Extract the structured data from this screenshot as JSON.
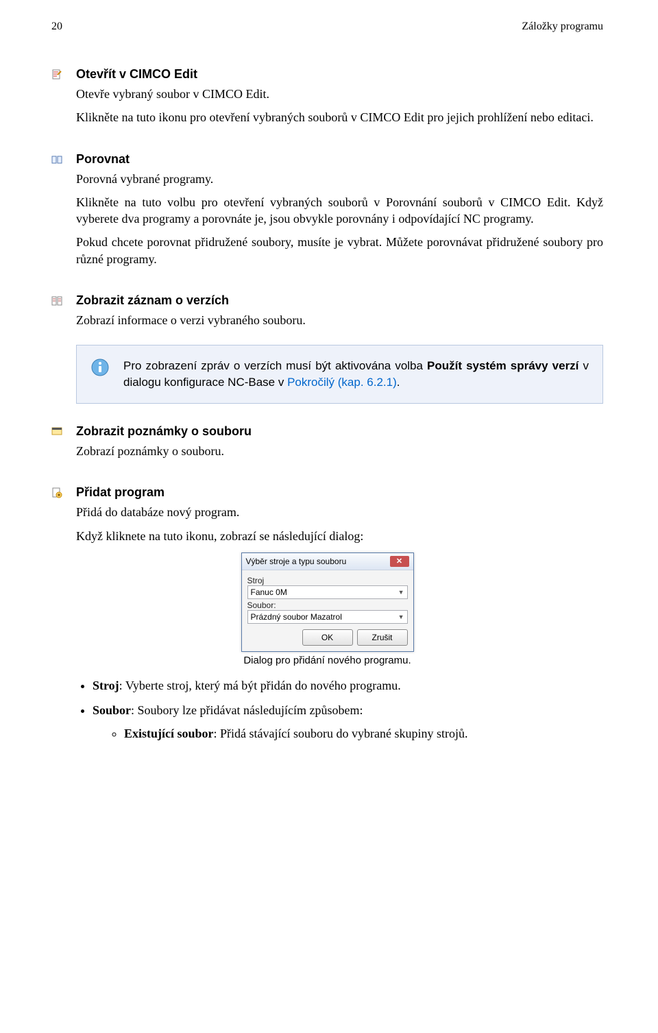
{
  "header": {
    "page_no": "20",
    "section": "Záložky programu"
  },
  "sections": [
    {
      "icon": "doc-edit-icon",
      "title": "Otevřít v CIMCO Edit",
      "paras": [
        "Otevře vybraný soubor v CIMCO Edit.",
        "Klikněte na tuto ikonu pro otevření vybraných souborů v CIMCO Edit pro jejich prohlížení nebo editaci."
      ]
    },
    {
      "icon": "compare-icon",
      "title": "Porovnat",
      "paras": [
        "Porovná vybrané programy.",
        "Klikněte na tuto volbu pro otevření vybraných souborů v Porovnání souborů v CIMCO Edit. Když vyberete dva programy a porovnáte je, jsou obvykle porovnány i odpovídající NC programy.",
        "Pokud chcete porovnat přidružené soubory, musíte je vybrat. Můžete porovnávat přidružené soubory pro různé programy."
      ]
    },
    {
      "icon": "version-icon",
      "title": "Zobrazit záznam o verzích",
      "paras": [
        "Zobrazí informace o verzi vybraného souboru."
      ]
    }
  ],
  "info": {
    "text_before": "Pro zobrazení zpráv o verzích musí být aktivována volba ",
    "bold1": "Použít systém správy verzí",
    "text_mid": " v dialogu konfigurace NC-Base v ",
    "link": "Pokročilý (kap. 6.2.1)",
    "text_after": "."
  },
  "sections2": [
    {
      "icon": "notes-icon",
      "title": "Zobrazit poznámky o souboru",
      "paras": [
        "Zobrazí poznámky o souboru."
      ]
    },
    {
      "icon": "add-program-icon",
      "title": "Přidat program",
      "paras": [
        "Přidá do databáze nový program.",
        "Když kliknete na tuto ikonu, zobrazí se následující dialog:"
      ]
    }
  ],
  "dialog": {
    "title": "Výběr stroje a typu souboru",
    "label1": "Stroj",
    "value1": "Fanuc 0M",
    "label2": "Soubor:",
    "value2": "Prázdný soubor Mazatrol",
    "ok": "OK",
    "cancel": "Zrušit"
  },
  "caption": "Dialog pro přidání nového programu.",
  "bullets": {
    "b1_label": "Stroj",
    "b1_text": ": Vyberte stroj, který má být přidán do nového programu.",
    "b2_label": "Soubor",
    "b2_text": ": Soubory lze přidávat následujícím způsobem:",
    "sub1_label": "Existující soubor",
    "sub1_text": ": Přidá stávající souboru do vybrané skupiny strojů."
  }
}
